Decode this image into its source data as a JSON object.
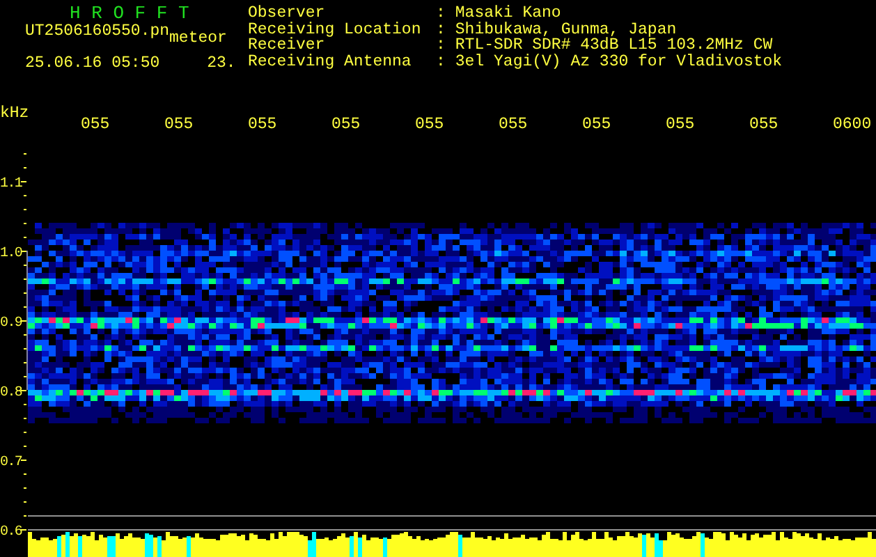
{
  "header": {
    "title": "H R O F F T",
    "file": "UT2506160550.pn",
    "mode": "meteor",
    "datetime": "25.06.16 05:50",
    "count": "23."
  },
  "info": [
    {
      "label": "Observer",
      "separator": ":",
      "value": "Masaki Kano"
    },
    {
      "label": "Receiving Location",
      "separator": ":",
      "value": "Shibukawa, Gunma, Japan"
    },
    {
      "label": "Receiver",
      "separator": ":",
      "value": "RTL-SDR SDR# 43dB L15 103.2MHz CW"
    },
    {
      "label": "Receiving Antenna",
      "separator": ":",
      "value": "3el Yagi(V) Az 330 for Vladivostok"
    }
  ],
  "axis": {
    "unit": "kHz",
    "time_labels": [
      "055",
      "055",
      "055",
      "055",
      "055",
      "055",
      "055",
      "055",
      "055",
      "0600"
    ],
    "freq_labels": [
      "1.1",
      "1.0",
      "0.9",
      "0.8",
      "0.7",
      "0.6"
    ]
  }
}
